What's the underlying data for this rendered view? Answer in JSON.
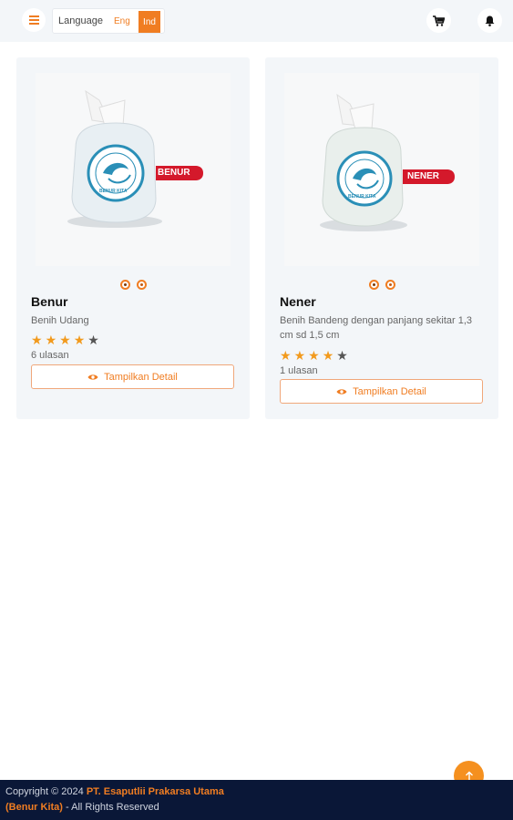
{
  "header": {
    "language_label": "Language",
    "lang_options": [
      "Eng",
      "Ind"
    ],
    "selected_lang": "Ind",
    "accent_color": "#f07d22"
  },
  "products": [
    {
      "name": "Benur",
      "description": "Benih Udang",
      "tag_text": "BENUR",
      "bag_text": "BENUR KITA",
      "rating": 4,
      "max_rating": 5,
      "reviews": "6 ulasan",
      "button_label": "Tampilkan Detail"
    },
    {
      "name": "Nener",
      "description": "Benih Bandeng dengan panjang sekitar 1,3 cm sd 1,5 cm",
      "tag_text": "NENER",
      "bag_text": "BENUR KITA",
      "rating": 4,
      "max_rating": 5,
      "reviews": "1 ulasan",
      "button_label": "Tampilkan Detail"
    }
  ],
  "footer": {
    "prefix": "Copyright © 2024 ",
    "company": "PT. Esaputlii Prakarsa Utama",
    "brand": "(Benur Kita)",
    "suffix": " - All Rights Reserved"
  },
  "icons": {
    "menu": "hamburger-icon",
    "cart": "cart-icon",
    "bell": "bell-icon",
    "view": "eye-icon",
    "scroll_top": "arrow-up-icon"
  }
}
